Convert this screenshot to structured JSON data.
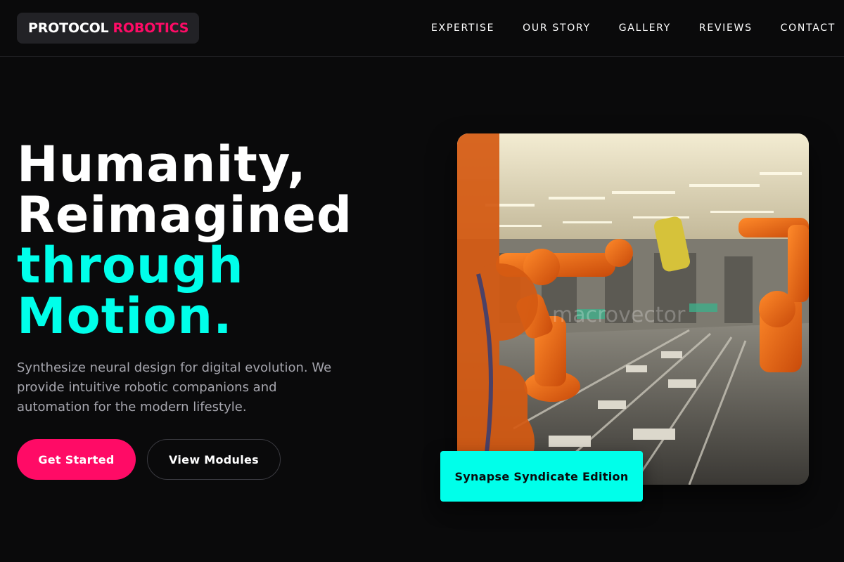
{
  "header": {
    "logo_primary": "PROTOCOL",
    "logo_accent": "ROBOTICS",
    "nav": [
      "EXPERTISE",
      "OUR STORY",
      "GALLERY",
      "REVIEWS",
      "CONTACT"
    ]
  },
  "hero": {
    "headline_line1": "Humanity,",
    "headline_line2": "Reimagined",
    "headline_line3": "through",
    "headline_line4": "Motion.",
    "description": "Synthesize neural design for digital evolution. We provide intuitive robotic companions and automation for the modern lifestyle.",
    "primary_button": "Get Started",
    "secondary_button": "View Modules",
    "image_watermark": "macrovector",
    "badge": "Synapse Syndicate Edition"
  },
  "colors": {
    "background": "#0a0a0b",
    "brand_pink": "#ff0b66",
    "brand_cyan": "#00ffea",
    "muted_text": "#a6a6ae"
  }
}
